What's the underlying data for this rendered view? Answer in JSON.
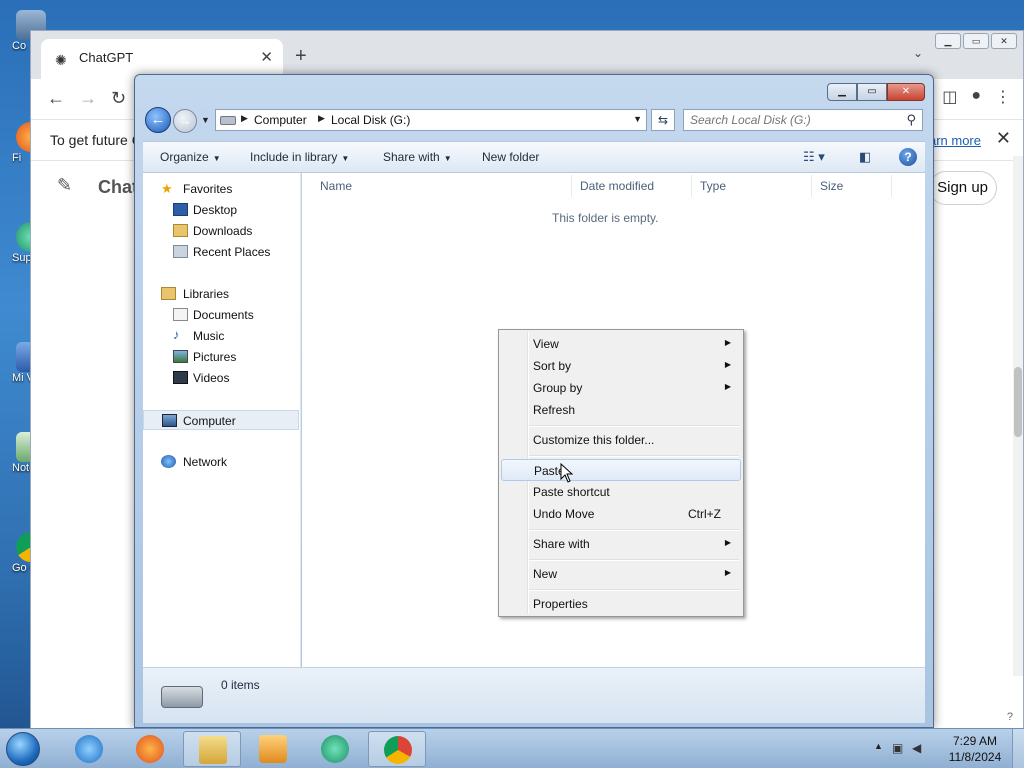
{
  "desktop": {
    "icons": [
      {
        "label": "Co"
      },
      {
        "label": "Fi"
      },
      {
        "label": "Supe"
      },
      {
        "label": "Mi Visua"
      },
      {
        "label": "Note"
      },
      {
        "label": "Go Ch"
      }
    ]
  },
  "browser": {
    "tab_title": "ChatGPT",
    "new_tab_glyph": "+",
    "infobar_text": "To get future G",
    "infobar_link": "arn more",
    "page_title": "Chat",
    "signup_label": "Sign up",
    "help_glyph": "?"
  },
  "explorer": {
    "breadcrumb": [
      "Computer",
      "Local Disk (G:)"
    ],
    "search_placeholder": "Search Local Disk (G:)",
    "commands": [
      {
        "label": "Organize",
        "dropdown": true
      },
      {
        "label": "Include in library",
        "dropdown": true
      },
      {
        "label": "Share with",
        "dropdown": true
      },
      {
        "label": "New folder",
        "dropdown": false
      }
    ],
    "nav": {
      "favorites": "Favorites",
      "desktop": "Desktop",
      "downloads": "Downloads",
      "recent": "Recent Places",
      "libraries": "Libraries",
      "documents": "Documents",
      "music": "Music",
      "pictures": "Pictures",
      "videos": "Videos",
      "computer": "Computer",
      "network": "Network"
    },
    "columns": [
      "Name",
      "Date modified",
      "Type",
      "Size"
    ],
    "empty_message": "This folder is empty.",
    "status": "0 items"
  },
  "context_menu": {
    "view": "View",
    "sort_by": "Sort by",
    "group_by": "Group by",
    "refresh": "Refresh",
    "customize": "Customize this folder...",
    "paste": "Paste",
    "paste_shortcut": "Paste shortcut",
    "undo_move": "Undo Move",
    "undo_shortcut": "Ctrl+Z",
    "share_with": "Share with",
    "new": "New",
    "properties": "Properties"
  },
  "taskbar": {
    "time": "7:29 AM",
    "date": "11/8/2024"
  },
  "colors": {
    "accent": "#1a5fb4",
    "menu_hover": "#dfeaf7"
  }
}
